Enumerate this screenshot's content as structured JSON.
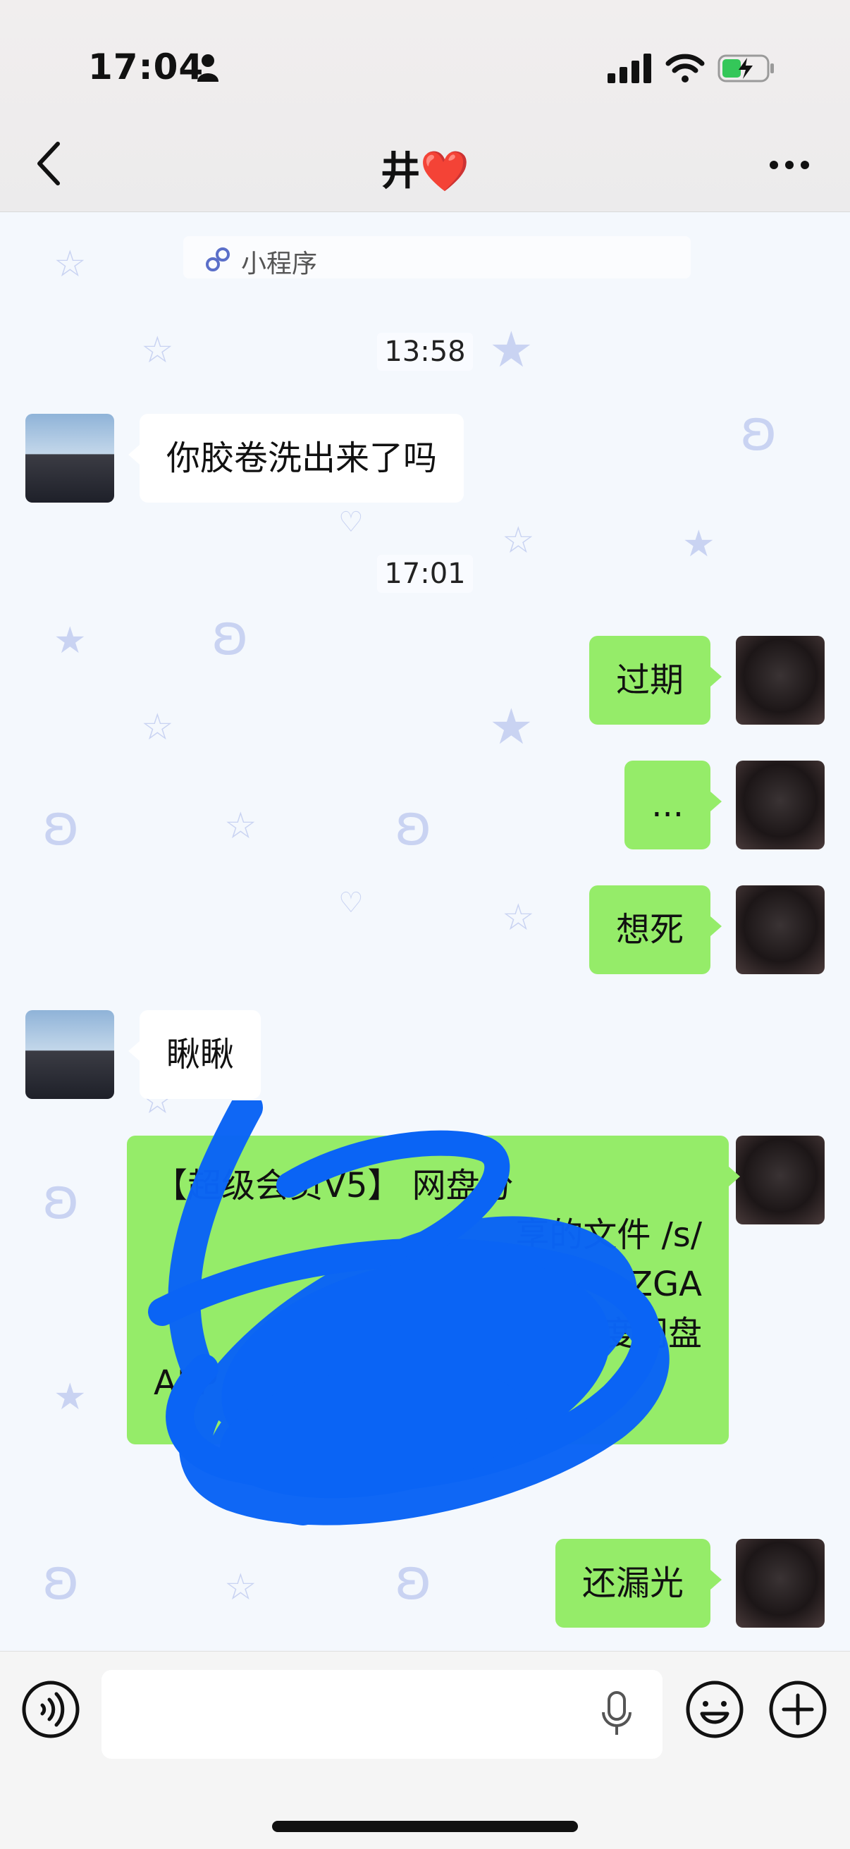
{
  "status": {
    "time": "17:04"
  },
  "header": {
    "title": "井",
    "title_emoji": "❤️"
  },
  "mini_program": {
    "label": "小程序"
  },
  "timestamps": [
    "13:58",
    "17:01"
  ],
  "messages": [
    {
      "side": "in",
      "text": "你胶卷洗出来了吗"
    },
    {
      "side": "out",
      "text": "过期"
    },
    {
      "side": "out",
      "text": "..."
    },
    {
      "side": "out",
      "text": "想死"
    },
    {
      "side": "in",
      "text": "瞅瞅"
    },
    {
      "side": "out",
      "text": "【超级会员 分享的文 ，/s/ ZGA 百度网盘 APP 获取」",
      "lines": [
        "【超级会员V5】 网盘分",
        "享的文件 /s/",
        "1 ZGA",
        "百度网盘",
        "APP 获取」"
      ]
    },
    {
      "side": "out",
      "text": "还漏光"
    }
  ],
  "colors": {
    "bubble_out": "#95ec69",
    "bubble_in": "#ffffff",
    "scribble": "#0a64f5"
  }
}
